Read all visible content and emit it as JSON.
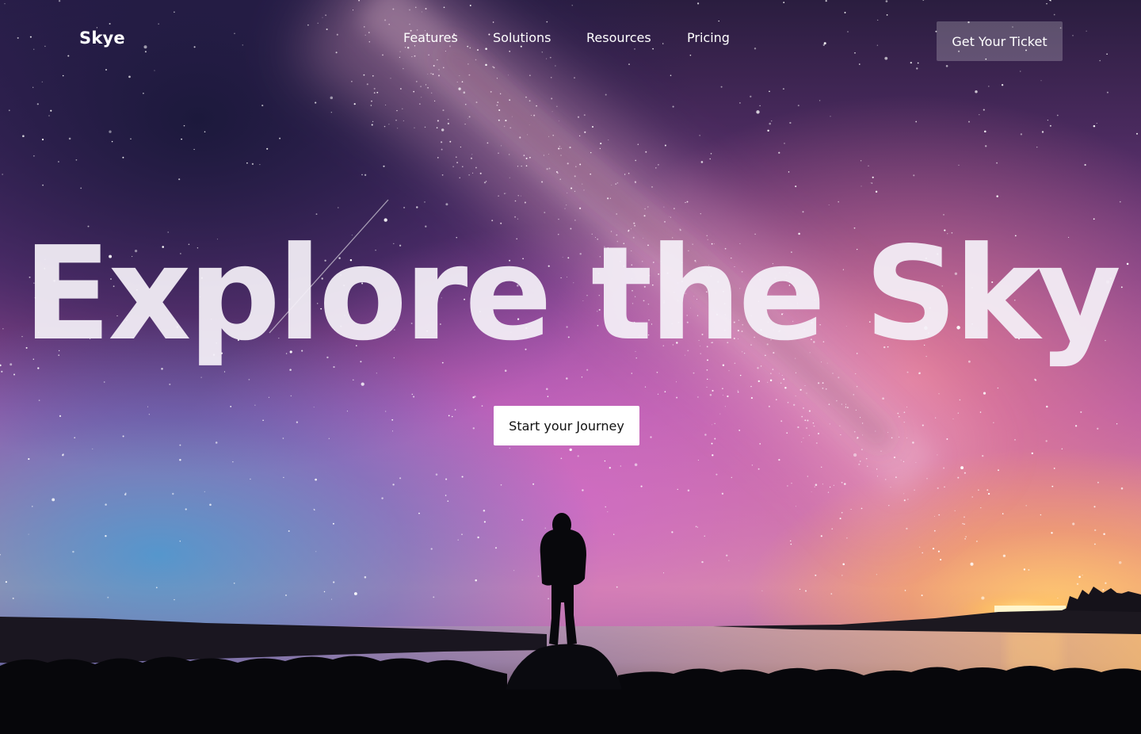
{
  "brand": {
    "name": "Skye"
  },
  "nav": {
    "links": [
      {
        "label": "Features"
      },
      {
        "label": "Solutions"
      },
      {
        "label": "Resources"
      },
      {
        "label": "Pricing"
      }
    ],
    "ticket_label": "Get Your Ticket"
  },
  "hero": {
    "headline": "Explore the Sky",
    "cta_label": "Start your Journey"
  },
  "colors": {
    "cta_background": "#ffffff",
    "cta_text": "#111111",
    "nav_button_background": "rgba(255,255,255,0.22)",
    "text": "#ffffff"
  }
}
